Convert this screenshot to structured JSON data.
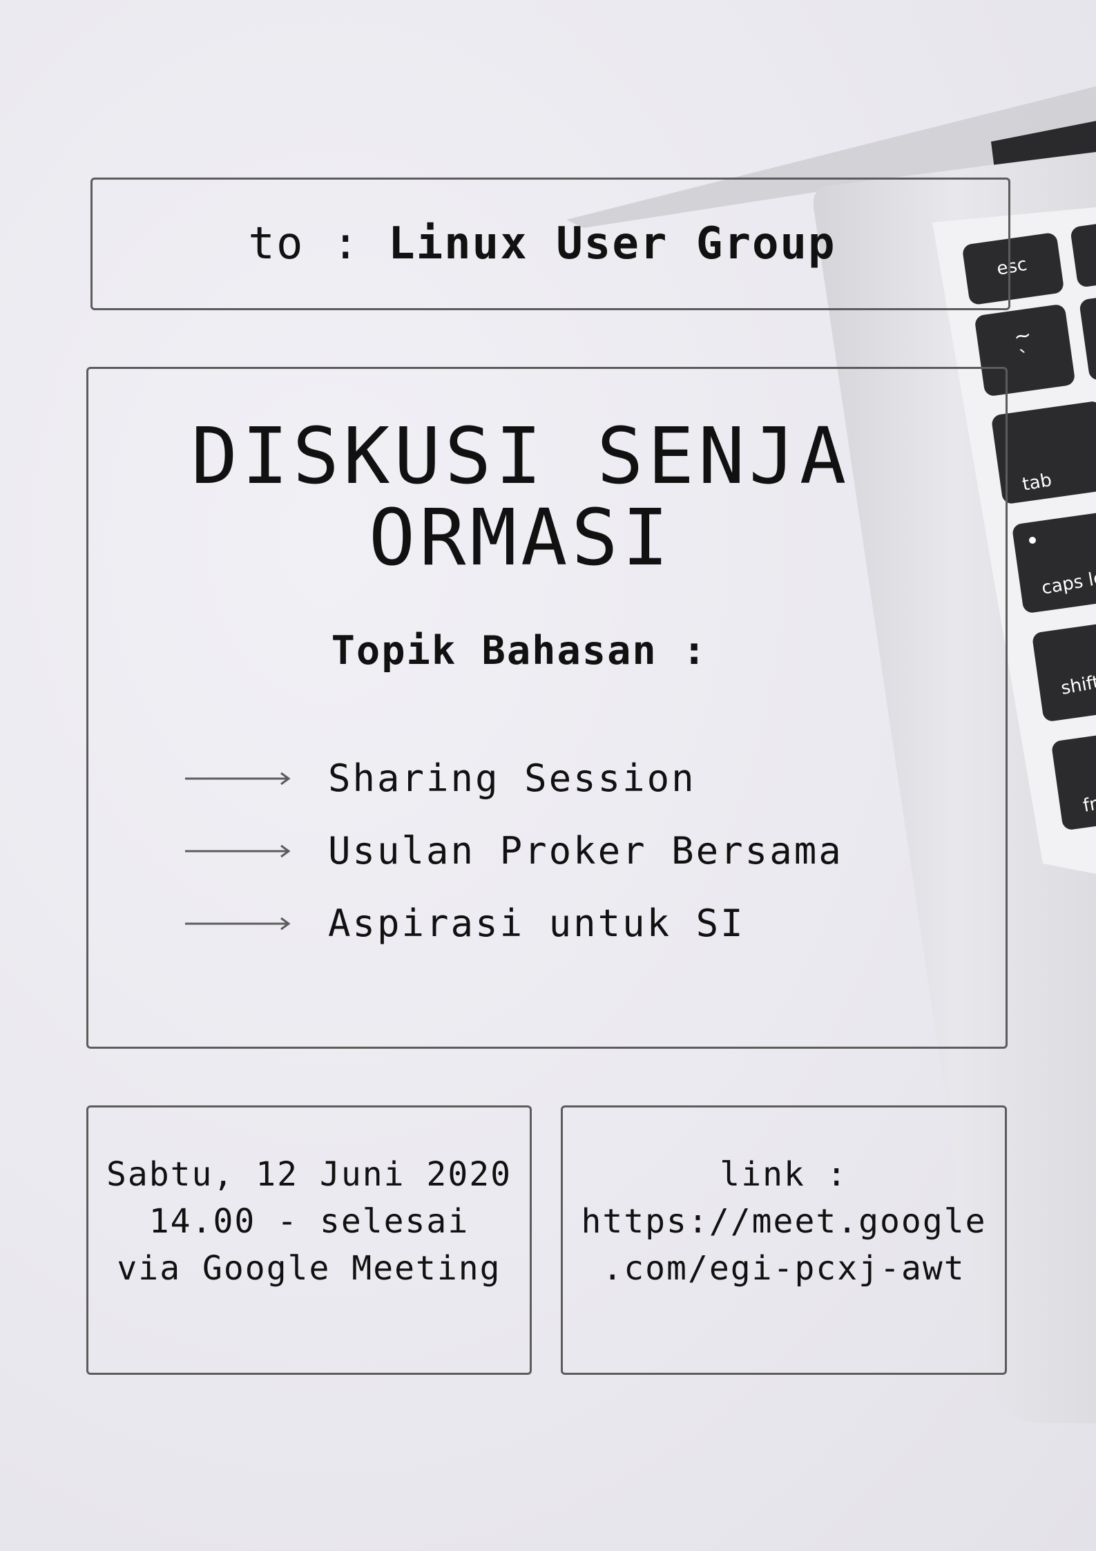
{
  "header": {
    "to_prefix": "to : ",
    "recipient": "Linux User Group"
  },
  "main": {
    "title_line1": "DISKUSI SENJA",
    "title_line2": "ORMASI",
    "subheading": "Topik Bahasan :",
    "topics": [
      "Sharing Session",
      "Usulan Proker Bersama",
      "Aspirasi untuk SI"
    ]
  },
  "schedule": {
    "date": "Sabtu, 12 Juni 2020",
    "time": "14.00 - selesai",
    "platform": "via Google Meeting"
  },
  "link": {
    "label": "link :",
    "url_line1": "https://meet.google",
    "url_line2": ".com/egi-pcxj-awt"
  },
  "keyboard_keys": [
    "esc",
    "~",
    "`",
    "tab",
    "caps lo",
    "shift",
    "fn"
  ],
  "colors": {
    "background": "#ecebf0",
    "frame": "#5c5c5c",
    "text": "#111111",
    "key": "#2b2b2d",
    "laptop_body": "#d9d9de"
  }
}
